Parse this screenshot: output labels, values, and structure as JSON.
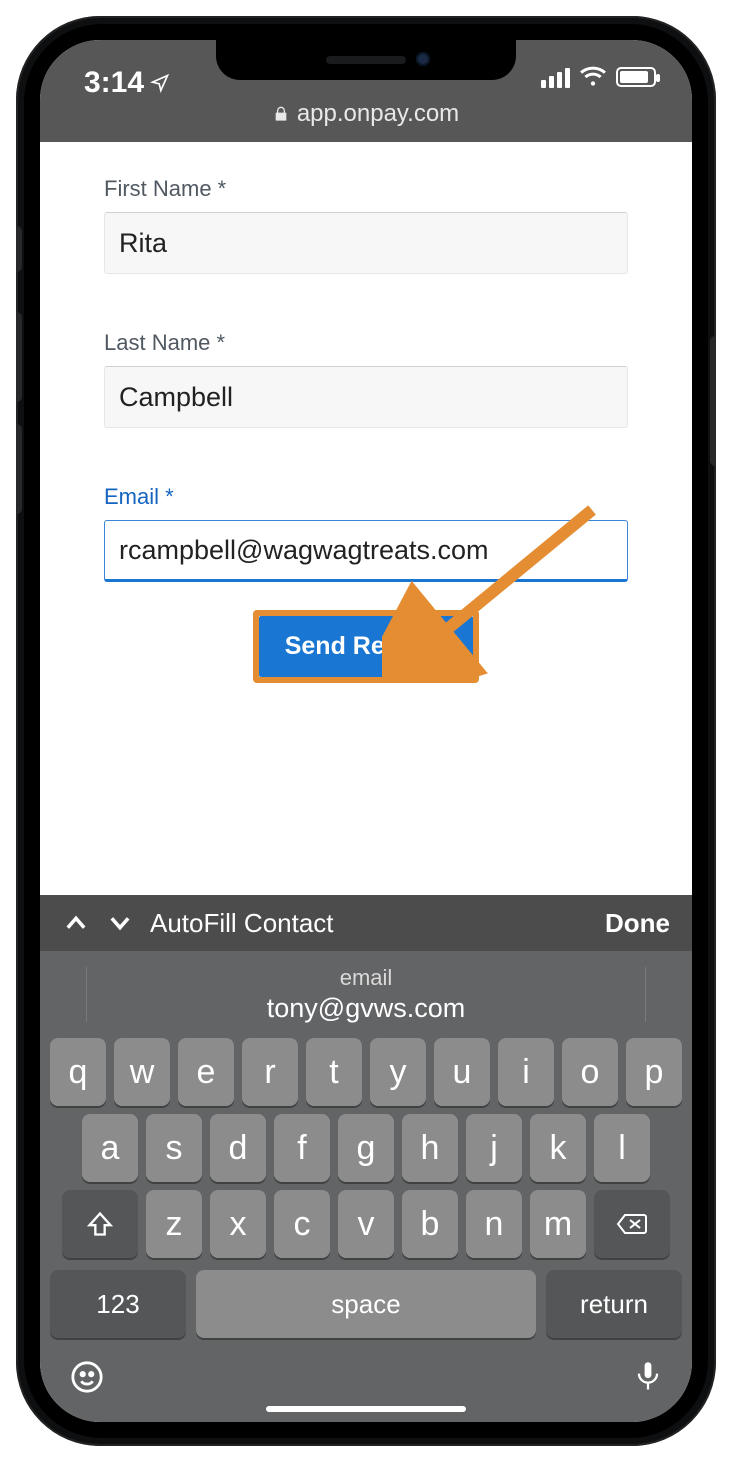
{
  "status": {
    "time": "3:14"
  },
  "browser": {
    "domain": "app.onpay.com"
  },
  "form": {
    "first_name": {
      "label": "First Name *",
      "value": "Rita"
    },
    "last_name": {
      "label": "Last Name *",
      "value": "Campbell"
    },
    "email": {
      "label": "Email *",
      "value": "rcampbell@wagwagtreats.com"
    },
    "submit_label": "Send Referral"
  },
  "assist_bar": {
    "autofill_label": "AutoFill Contact",
    "done_label": "Done"
  },
  "keyboard": {
    "suggestion": {
      "label": "email",
      "value": "tony@gvws.com"
    },
    "row1": [
      "q",
      "w",
      "e",
      "r",
      "t",
      "y",
      "u",
      "i",
      "o",
      "p"
    ],
    "row2": [
      "a",
      "s",
      "d",
      "f",
      "g",
      "h",
      "j",
      "k",
      "l"
    ],
    "row3": [
      "z",
      "x",
      "c",
      "v",
      "b",
      "n",
      "m"
    ],
    "numeric_label": "123",
    "space_label": "space",
    "return_label": "return"
  }
}
